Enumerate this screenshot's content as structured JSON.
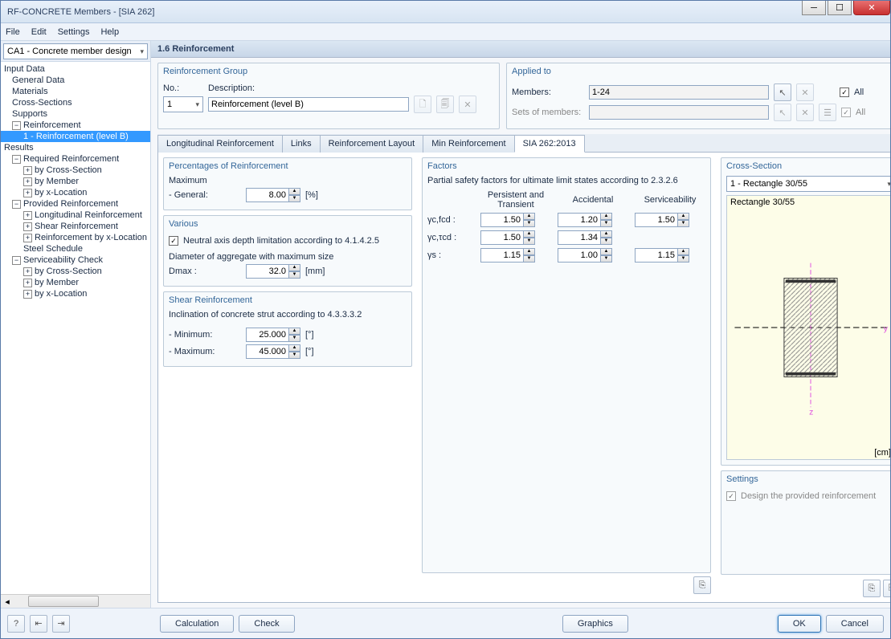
{
  "window": {
    "title": "RF-CONCRETE Members - [SIA 262]"
  },
  "menu": {
    "file": "File",
    "edit": "Edit",
    "settings": "Settings",
    "help": "Help"
  },
  "caseCombo": "CA1 - Concrete member design",
  "nav": {
    "inputData": "Input Data",
    "generalData": "General Data",
    "materials": "Materials",
    "crossSections": "Cross-Sections",
    "supports": "Supports",
    "reinforcement": "Reinforcement",
    "reinf1": "1 - Reinforcement (level B)",
    "results": "Results",
    "reqReinf": "Required Reinforcement",
    "byCS": "by Cross-Section",
    "byMember": "by Member",
    "byXLoc": "by x-Location",
    "provReinf": "Provided Reinforcement",
    "longReinf": "Longitudinal Reinforcement",
    "shearReinf": "Shear Reinforcement",
    "reinfByX": "Reinforcement by x-Location",
    "steelSched": "Steel Schedule",
    "servCheck": "Serviceability Check"
  },
  "page": {
    "title": "1.6 Reinforcement"
  },
  "reinfGroup": {
    "title": "Reinforcement Group",
    "noLabel": "No.:",
    "no": "1",
    "descLabel": "Description:",
    "desc": "Reinforcement (level B)"
  },
  "applied": {
    "title": "Applied to",
    "membersLabel": "Members:",
    "members": "1-24",
    "setsLabel": "Sets of members:",
    "all": "All"
  },
  "tabs": {
    "long": "Longitudinal Reinforcement",
    "links": "Links",
    "layout": "Reinforcement Layout",
    "min": "Min Reinforcement",
    "sia": "SIA 262:2013"
  },
  "percent": {
    "title": "Percentages of Reinforcement",
    "maximum": "Maximum",
    "general": "- General:",
    "value": "8.00",
    "unit": "[%]"
  },
  "various": {
    "title": "Various",
    "neutral": "Neutral axis depth limitation according to 4.1.4.2.5",
    "aggLabel": "Diameter of aggregate with maximum size",
    "dmax": "Dmax :",
    "dmaxVal": "32.0",
    "unit": "[mm]"
  },
  "shear": {
    "title": "Shear Reinforcement",
    "inclination": "Inclination of concrete strut according to 4.3.3.3.2",
    "min": "- Minimum:",
    "minVal": "25.000",
    "max": "- Maximum:",
    "maxVal": "45.000",
    "unit": "[°]"
  },
  "factors": {
    "title": "Factors",
    "note": "Partial safety factors for ultimate limit states according to 2.3.2.6",
    "col1": "Persistent and Transient",
    "col2": "Accidental",
    "col3": "Serviceability",
    "r1": "γc,fcd :",
    "r1v1": "1.50",
    "r1v2": "1.20",
    "r1v3": "1.50",
    "r2": "γc,τcd :",
    "r2v1": "1.50",
    "r2v2": "1.34",
    "r3": "γs :",
    "r3v1": "1.15",
    "r3v2": "1.00",
    "r3v3": "1.15"
  },
  "cs": {
    "title": "Cross-Section",
    "combo": "1 - Rectangle 30/55",
    "name": "Rectangle 30/55",
    "unit": "[cm]",
    "y": "y",
    "z": "z"
  },
  "settingsBox": {
    "title": "Settings",
    "design": "Design the provided reinforcement"
  },
  "footer": {
    "calc": "Calculation",
    "check": "Check",
    "graphics": "Graphics",
    "ok": "OK",
    "cancel": "Cancel"
  }
}
